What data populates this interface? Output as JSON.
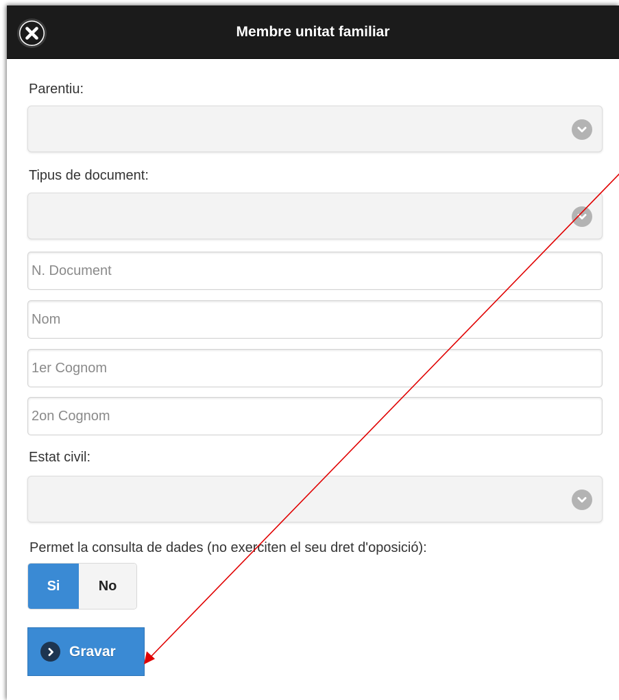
{
  "header": {
    "title": "Membre unitat familiar",
    "close_icon": "close-icon"
  },
  "form": {
    "parentiu_label": "Parentiu:",
    "parentiu_value": "",
    "tipus_document_label": "Tipus de document:",
    "tipus_document_value": "",
    "document_number_placeholder": "N. Document",
    "nom_placeholder": "Nom",
    "cognom1_placeholder": "1er Cognom",
    "cognom2_placeholder": "2on Cognom",
    "estat_civil_label": "Estat civil:",
    "estat_civil_value": "",
    "consulta_label": "Permet la consulta de dades (no exerciten el seu dret d'oposició):",
    "toggle": {
      "yes_label": "Si",
      "no_label": "No",
      "selected": "Si"
    },
    "save_label": "Gravar"
  },
  "colors": {
    "header_bg": "#1b1b1b",
    "accent": "#3a8ad4",
    "annotation_arrow": "#e00000"
  },
  "icons": {
    "select_chevron": "chevron-down-icon",
    "save_arrow": "chevron-right-icon"
  }
}
